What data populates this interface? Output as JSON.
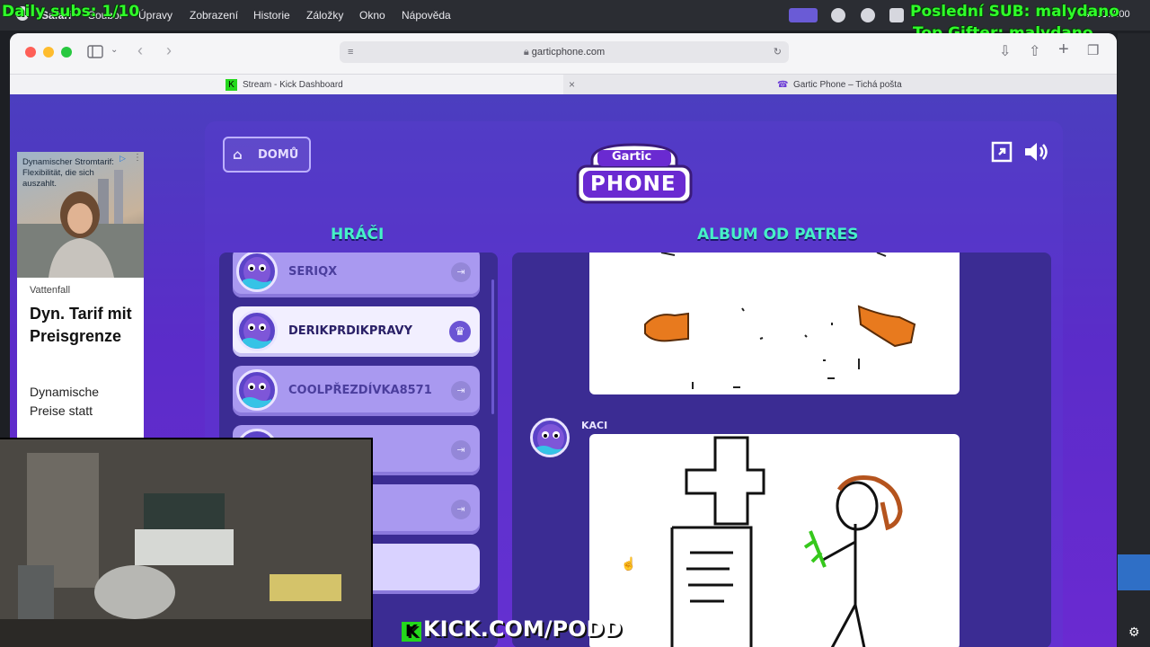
{
  "overlay": {
    "daily_subs": "Daily subs: 1/10",
    "last_sub": "Poslední SUB: malydano",
    "top_gifter": "Top Gifter: malydano",
    "kick_url": "KICK.COM/PODD"
  },
  "menubar": {
    "app": "Safari",
    "items": [
      "Soubor",
      "Úpravy",
      "Zobrazení",
      "Historie",
      "Záložky",
      "Okno",
      "Nápověda"
    ],
    "clock": "so 11:3:00"
  },
  "browser": {
    "address": "garticphone.com",
    "tabs": [
      {
        "label": "Stream - Kick Dashboard",
        "active": true
      },
      {
        "label": "Gartic Phone – Tichá pošta",
        "active": false
      }
    ]
  },
  "ad": {
    "headline_top": "Dynamischer Stromtarif: Flexibilität, die sich auszahlt.",
    "brand": "Vattenfall",
    "title": "Dyn. Tarif mit Preisgrenze",
    "body": "Dynamische Preise statt"
  },
  "game": {
    "home_label": "DOMŮ",
    "logo_top": "Gartic",
    "logo_bottom": "PHONE",
    "players_heading": "HRÁČI",
    "album_heading": "ALBUM OD PATRES",
    "players": [
      {
        "name": "SERIQX",
        "host": false
      },
      {
        "name": "DERIKPRDIKPRAVY",
        "host": true
      },
      {
        "name": "COOLPŘEZDÍVKA8571",
        "host": false
      },
      {
        "name": "",
        "host": false
      },
      {
        "name": "",
        "host": false
      },
      {
        "name": "",
        "host": false
      }
    ],
    "drawing_author": "KACI"
  },
  "colors": {
    "accent_green": "#46f1c7",
    "stream_green": "#30ff2a",
    "background_purple": "#5b2cc9"
  }
}
